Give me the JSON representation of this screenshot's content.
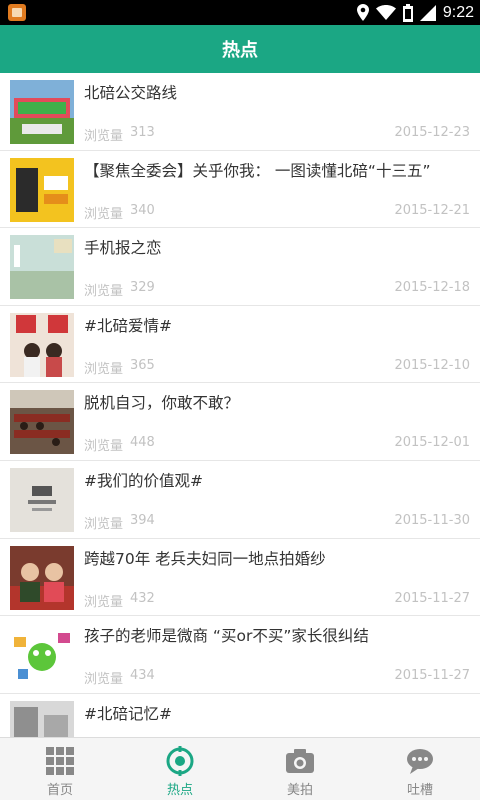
{
  "status_bar": {
    "time": "9:22",
    "icons": [
      "app-notification-icon",
      "location-icon",
      "wifi-icon",
      "battery-icon",
      "signal-icon"
    ]
  },
  "header": {
    "title": "热点"
  },
  "list": {
    "views_label": "浏览量",
    "items": [
      {
        "title": "北碚公交路线",
        "views": "313",
        "date": "2015-12-23"
      },
      {
        "title": "【聚焦全委会】关乎你我： 一图读懂北碚“十三五”",
        "views": "340",
        "date": "2015-12-21"
      },
      {
        "title": "手机报之恋",
        "views": "329",
        "date": "2015-12-18"
      },
      {
        "title": "#北碚爱情#",
        "views": "365",
        "date": "2015-12-10"
      },
      {
        "title": "脱机自习，你敢不敢？",
        "views": "448",
        "date": "2015-12-01"
      },
      {
        "title": "#我们的价值观#",
        "views": "394",
        "date": "2015-11-30"
      },
      {
        "title": "跨越70年 老兵夫妇同一地点拍婚纱",
        "views": "432",
        "date": "2015-11-27"
      },
      {
        "title": "孩子的老师是微商 “买or不买”家长很纠结",
        "views": "434",
        "date": "2015-11-27"
      },
      {
        "title": "#北碚记忆#",
        "views": "",
        "date": ""
      }
    ]
  },
  "bottom_nav": {
    "items": [
      {
        "label": "首页",
        "icon": "grid-icon"
      },
      {
        "label": "热点",
        "icon": "target-icon",
        "active": true
      },
      {
        "label": "美拍",
        "icon": "camera-icon"
      },
      {
        "label": "吐槽",
        "icon": "chat-bubble-icon"
      }
    ]
  },
  "colors": {
    "accent": "#1ba784",
    "muted_text": "#c2c2c2",
    "title_text": "#333333"
  }
}
